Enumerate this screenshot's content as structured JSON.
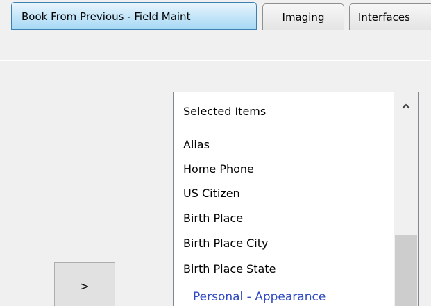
{
  "tabs": [
    {
      "label": "Book From Previous - Field Maint",
      "active": true
    },
    {
      "label": "Imaging",
      "active": false
    },
    {
      "label": "Interfaces",
      "active": false
    }
  ],
  "selected_list": {
    "header": "Selected Items",
    "items": [
      "Alias",
      "Home Phone",
      "US Citizen",
      "Birth Place",
      "Birth Place City",
      "Birth Place State"
    ],
    "group_header": "Personal - Appearance"
  },
  "move_button": {
    "label": ">"
  },
  "icons": {
    "scroll_up": "chevron-up-icon"
  },
  "colors": {
    "active_tab_border": "#3c7fb1",
    "group_header_text": "#2f49c2"
  }
}
